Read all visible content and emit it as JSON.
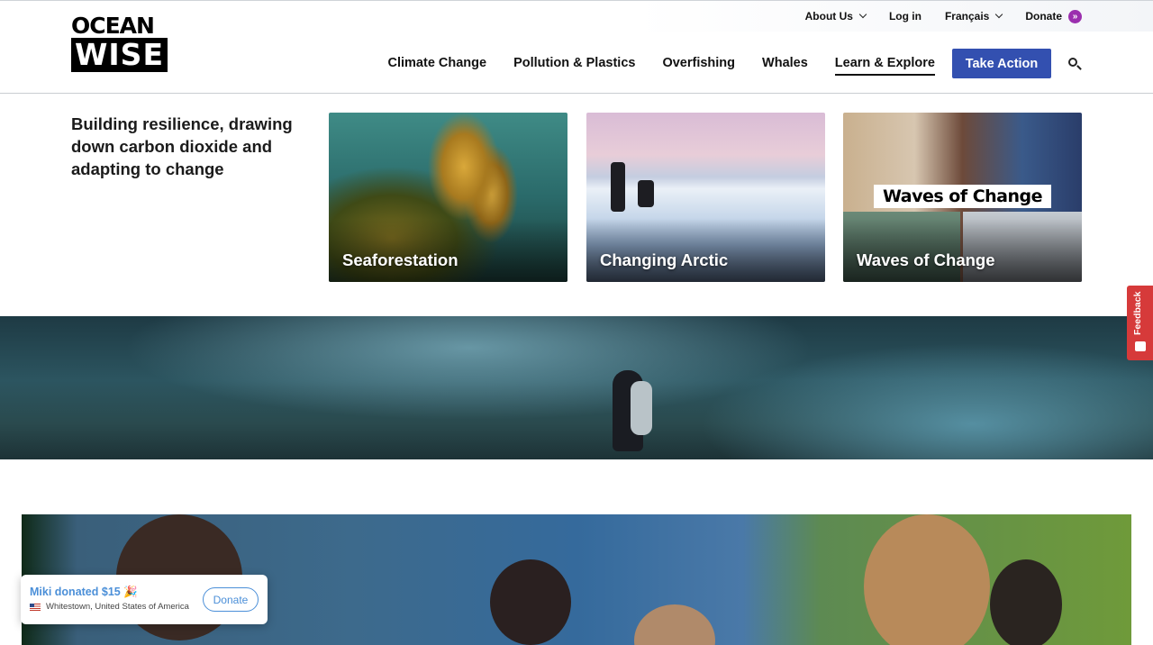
{
  "header": {
    "logo_top": "OCEAN",
    "logo_bottom": "WISE",
    "utility": {
      "about": "About Us",
      "login": "Log in",
      "language": "Français",
      "donate": "Donate"
    },
    "nav": [
      {
        "label": "Climate Change",
        "active": false
      },
      {
        "label": "Pollution & Plastics",
        "active": false
      },
      {
        "label": "Overfishing",
        "active": false
      },
      {
        "label": "Whales",
        "active": false
      },
      {
        "label": "Learn & Explore",
        "active": true
      }
    ],
    "cta": "Take Action",
    "search_icon": "search-icon"
  },
  "intro": {
    "text": "Building resilience, drawing down carbon dioxide and adapting to change"
  },
  "cards": [
    {
      "label": "Seaforestation"
    },
    {
      "label": "Changing Arctic"
    },
    {
      "label": "Waves of Change",
      "banner": "Waves of Change"
    }
  ],
  "toast": {
    "title": "Miki donated $15 🎉",
    "location": "Whitestown, United States of America",
    "button": "Donate"
  },
  "feedback": {
    "label": "Feedback"
  },
  "colors": {
    "cta": "#3350b0",
    "donate_accent": "#9b2fae",
    "toast_accent": "#4b8fd8",
    "feedback": "#d63a3a"
  }
}
